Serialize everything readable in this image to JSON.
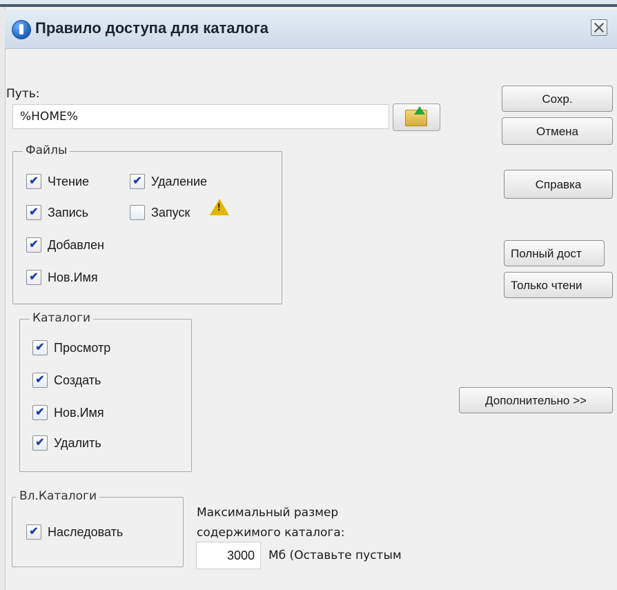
{
  "dialog": {
    "title": "Правило доступа для каталога",
    "close_icon": "close-icon"
  },
  "path": {
    "label": "Путь:",
    "value": "%HOME%",
    "browse_icon": "folder-up-icon"
  },
  "files_group": {
    "title": "Файлы",
    "items": [
      {
        "label": "Чтение",
        "checked": true
      },
      {
        "label": "Удаление",
        "checked": true
      },
      {
        "label": "Запись",
        "checked": true
      },
      {
        "label": "Запуск",
        "checked": false
      },
      {
        "label": "Добавлен",
        "checked": true
      },
      {
        "label": "Нов.Имя",
        "checked": true
      }
    ],
    "warning_icon": "warning-icon"
  },
  "catalogs_group": {
    "title": "Каталоги",
    "items": [
      {
        "label": "Просмотр",
        "checked": true
      },
      {
        "label": "Создать",
        "checked": true
      },
      {
        "label": "Нов.Имя",
        "checked": true
      },
      {
        "label": "Удалить",
        "checked": true
      }
    ]
  },
  "subcatalogs_group": {
    "title": "Вл.Каталоги",
    "items": [
      {
        "label": "Наследовать",
        "checked": true
      }
    ]
  },
  "max_size": {
    "label_line1": "Максимальный размер",
    "label_line2": "содержимого каталога:",
    "value": "3000",
    "unit_text": "Мб (Оставьте пустым"
  },
  "buttons": {
    "save": "Сохр.",
    "cancel": "Отмена",
    "help": "Справка",
    "full_access": "Полный дост",
    "read_only": "Только чтени",
    "advanced": "Дополнительно >>"
  }
}
